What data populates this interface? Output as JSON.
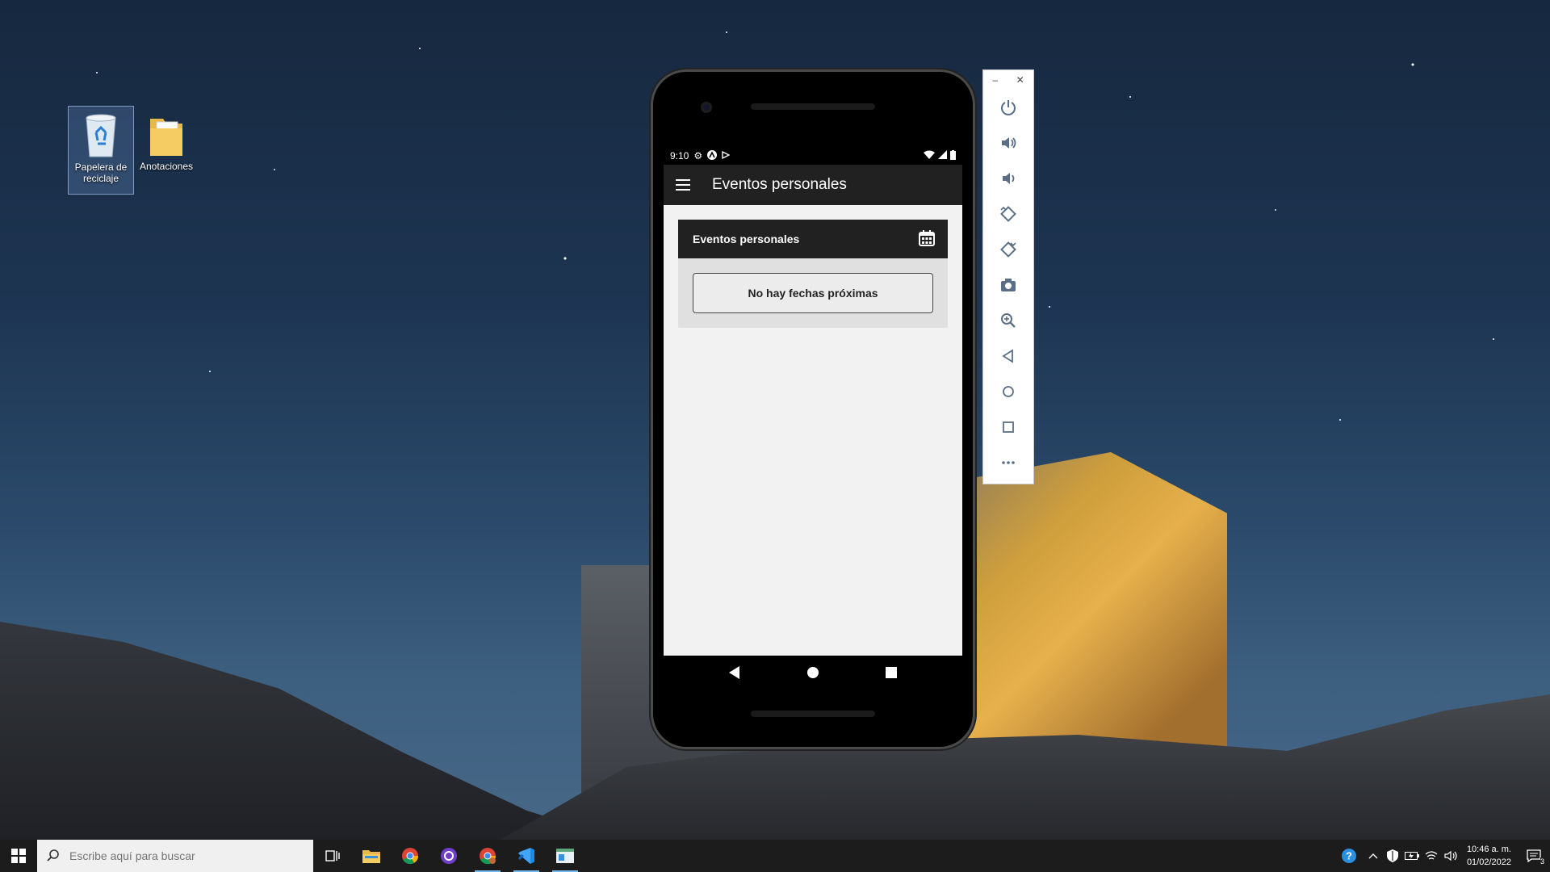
{
  "desktop": {
    "icons": [
      {
        "label": "Papelera de reciclaje"
      },
      {
        "label": "Anotaciones"
      }
    ]
  },
  "phone": {
    "status": {
      "time": "9:10"
    },
    "appbar": {
      "title": "Eventos personales"
    },
    "card": {
      "header": "Eventos personales",
      "empty_message": "No hay fechas próximas"
    }
  },
  "emulator_toolbar": {
    "buttons": [
      "power-icon",
      "volume-up-icon",
      "volume-down-icon",
      "rotate-left-icon",
      "rotate-right-icon",
      "camera-icon",
      "zoom-icon",
      "back-icon",
      "home-icon",
      "overview-icon",
      "more-icon"
    ]
  },
  "taskbar": {
    "search_placeholder": "Escribe aquí para buscar",
    "apps": [
      "task-view",
      "file-explorer",
      "chrome",
      "github-desktop",
      "chrome-profile",
      "vscode",
      "emulator"
    ],
    "clock": {
      "time": "10:46 a. m.",
      "date": "01/02/2022"
    },
    "notifications_count": "3"
  }
}
